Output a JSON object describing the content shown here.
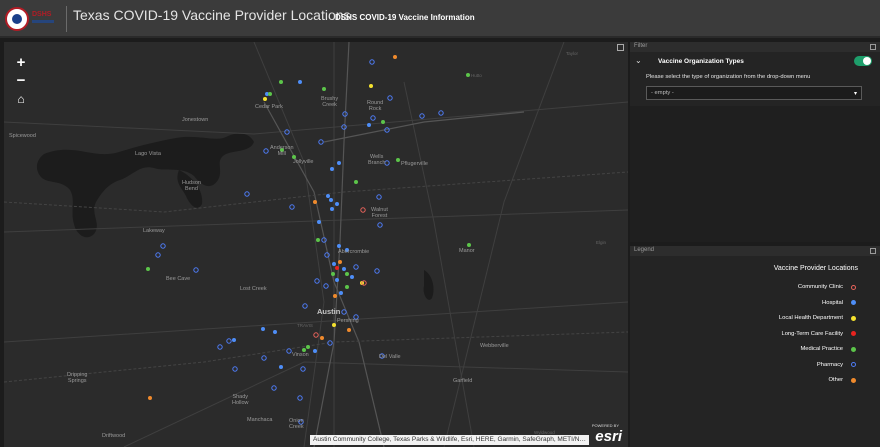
{
  "header": {
    "logo_text": "DSHS",
    "title": "Texas COVID-19 Vaccine Provider Locations",
    "link": "DSHS COVID-19 Vaccine Information"
  },
  "map": {
    "controls": {
      "zoom_in": "+",
      "zoom_out": "−",
      "home": "⌂"
    },
    "attribution": "Austin Community College, Texas Parks & Wildlife, Esri, HERE, Garmin, SafeGraph, METI/N…",
    "esri_powered": "POWERED BY",
    "esri_logo": "esri",
    "places": {
      "taylor": "Taylor",
      "hutto": "Hutto",
      "cedar_park": "Cedar Park",
      "brushy_creek": "Brushy\nCreek",
      "round_rock": "Round\nRock",
      "jonestown": "Jonestown",
      "spicewood": "Spicewood",
      "lago_vista": "Lago Vista",
      "anderson_mill": "Anderson\nMill",
      "jollyville": "Jollyville",
      "wells_branch": "Wells\nBranch",
      "pflugerville": "Pflugerville",
      "hudson_bend": "Hudson\nBend",
      "walnut_forest": "Walnut\nForest",
      "lakeway": "Lakeway",
      "elgin": "Elgin",
      "manor": "Manor",
      "abercrombie": "Abercrombie",
      "bee_cave": "Bee Cave",
      "lost_creek": "Lost Creek",
      "austin": "Austin",
      "pershing": "Pershing",
      "travis": "TRAVIS",
      "webberville": "Webberville",
      "vinson": "Vinson",
      "del_valle": "Del Valle",
      "dripping_springs": "Dripping\nSprings",
      "garfield": "Garfield",
      "shady_hollow": "Shady\nHollow",
      "manchaca": "Manchaca",
      "onion_creek": "Onion\nCreek",
      "driftwood": "Driftwood",
      "wyldwood": "Wyldwood"
    }
  },
  "filter": {
    "header": "Filter",
    "label": "Vaccine Organization Types",
    "toggle_on": true,
    "hint": "Please select the type of organization from the drop-down menu",
    "select_value": "- empty -"
  },
  "legend": {
    "header": "Legend",
    "title": "Vaccine Provider Locations",
    "items": [
      {
        "label": "Community Clinic",
        "color": "#e8635b",
        "style": "outline"
      },
      {
        "label": "Hospital",
        "color": "#4e8ef7",
        "style": "fill"
      },
      {
        "label": "Local Health Department",
        "color": "#f5e22f",
        "style": "fill"
      },
      {
        "label": "Long-Term Care Facility",
        "color": "#e8231f",
        "style": "fill"
      },
      {
        "label": "Medical Practice",
        "color": "#5cc54a",
        "style": "fill"
      },
      {
        "label": "Pharmacy",
        "color": "#4e7cf7",
        "style": "outline"
      },
      {
        "label": "Other",
        "color": "#f08a2c",
        "style": "fill"
      }
    ]
  }
}
